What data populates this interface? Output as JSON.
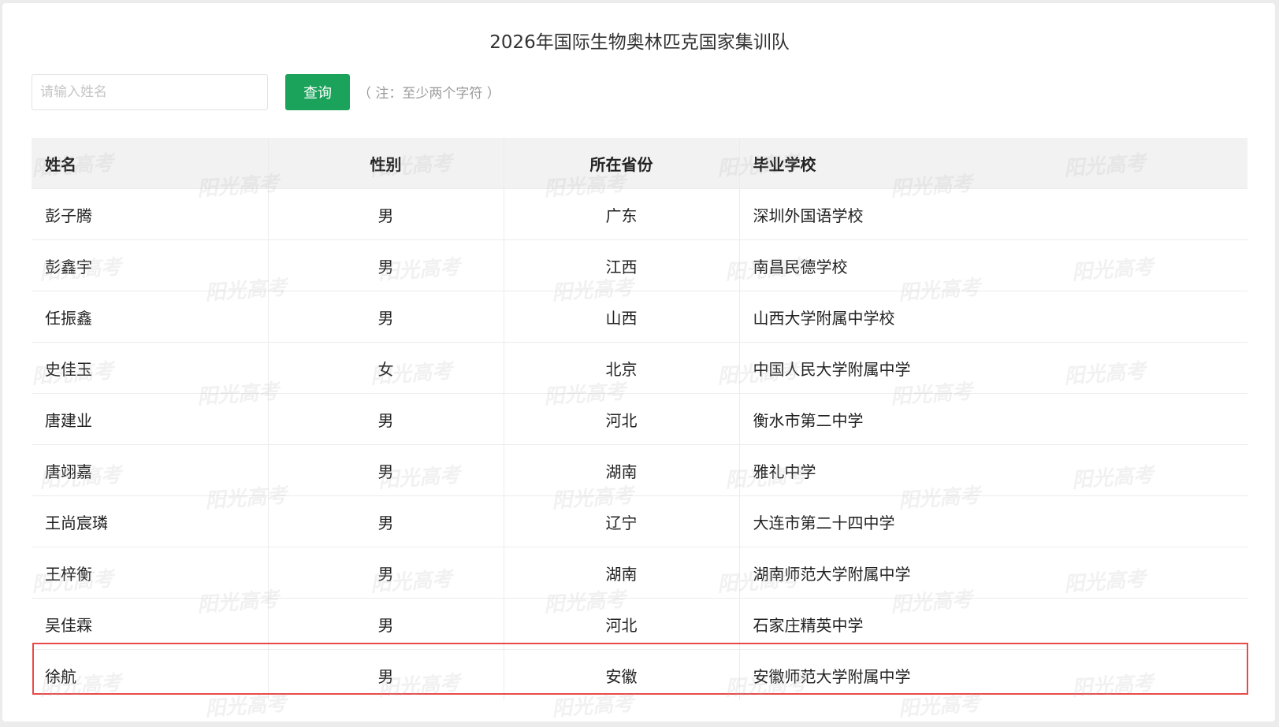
{
  "page": {
    "title": "2026年国际生物奥林匹克国家集训队"
  },
  "search": {
    "placeholder": "请输入姓名",
    "value": "",
    "button_label": "查询",
    "hint": "（ 注：至少两个字符 ）"
  },
  "table": {
    "columns": [
      "姓名",
      "性别",
      "所在省份",
      "毕业学校"
    ],
    "rows": [
      {
        "name": "彭子腾",
        "gender": "男",
        "province": "广东",
        "school": "深圳外国语学校"
      },
      {
        "name": "彭鑫宇",
        "gender": "男",
        "province": "江西",
        "school": "南昌民德学校"
      },
      {
        "name": "任振鑫",
        "gender": "男",
        "province": "山西",
        "school": "山西大学附属中学校"
      },
      {
        "name": "史佳玉",
        "gender": "女",
        "province": "北京",
        "school": "中国人民大学附属中学"
      },
      {
        "name": "唐建业",
        "gender": "男",
        "province": "河北",
        "school": "衡水市第二中学"
      },
      {
        "name": "唐翊嘉",
        "gender": "男",
        "province": "湖南",
        "school": "雅礼中学"
      },
      {
        "name": "王尚宸璘",
        "gender": "男",
        "province": "辽宁",
        "school": "大连市第二十四中学"
      },
      {
        "name": "王梓衡",
        "gender": "男",
        "province": "湖南",
        "school": "湖南师范大学附属中学"
      },
      {
        "name": "吴佳霖",
        "gender": "男",
        "province": "河北",
        "school": "石家庄精英中学"
      },
      {
        "name": "徐航",
        "gender": "男",
        "province": "安徽",
        "school": "安徽师范大学附属中学"
      }
    ],
    "highlighted_row": 9
  },
  "watermark": {
    "text": "阳光高考"
  },
  "colors": {
    "accent": "#1ca35b",
    "highlight_border": "#e84a4a",
    "header_bg": "#f2f2f2"
  }
}
